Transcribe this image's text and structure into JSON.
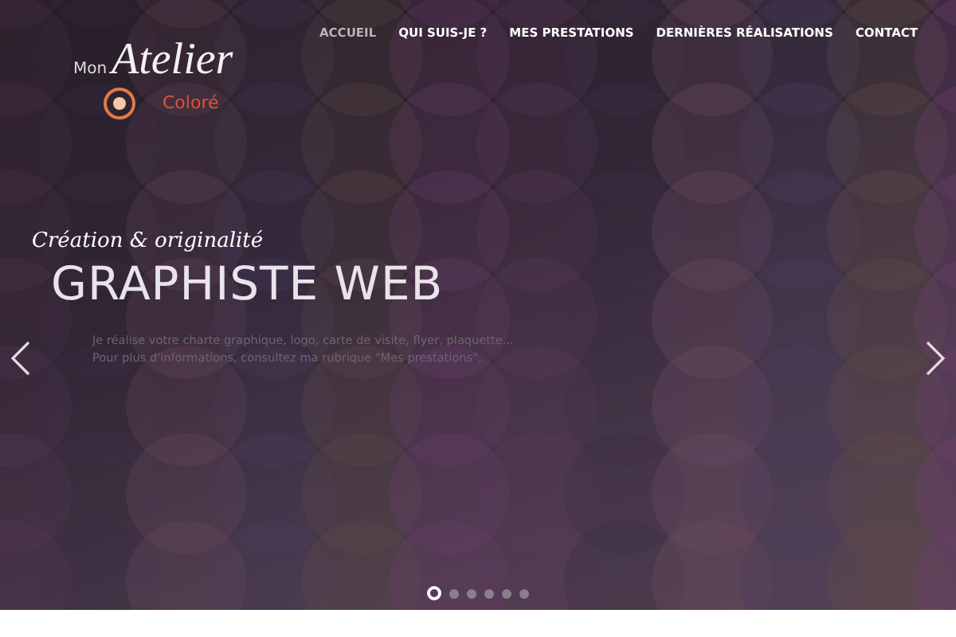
{
  "logo": {
    "word_1": "Mon",
    "word_2": "Atelier",
    "word_3": "Coloré"
  },
  "nav": [
    {
      "label": "ACCUEIL",
      "selected": true
    },
    {
      "label": "QUI SUIS-JE ?",
      "selected": false
    },
    {
      "label": "MES PRESTATIONS",
      "selected": false
    },
    {
      "label": "DERNIÈRES RÉALISATIONS",
      "selected": false
    },
    {
      "label": "CONTACT",
      "selected": false
    }
  ],
  "slide": {
    "tagline": "Création & originalité",
    "title": "GRAPHISTE WEB",
    "lines": [
      "Je réalise votre charte graphique, logo, carte de visite, flyer, plaquette...",
      "Pour plus d'informations, consultez ma rubrique \"Mes prestations\"."
    ]
  },
  "slider_dots": [
    {
      "selected": true
    },
    {
      "selected": false
    },
    {
      "selected": false
    },
    {
      "selected": false
    },
    {
      "selected": false
    },
    {
      "selected": false
    }
  ]
}
